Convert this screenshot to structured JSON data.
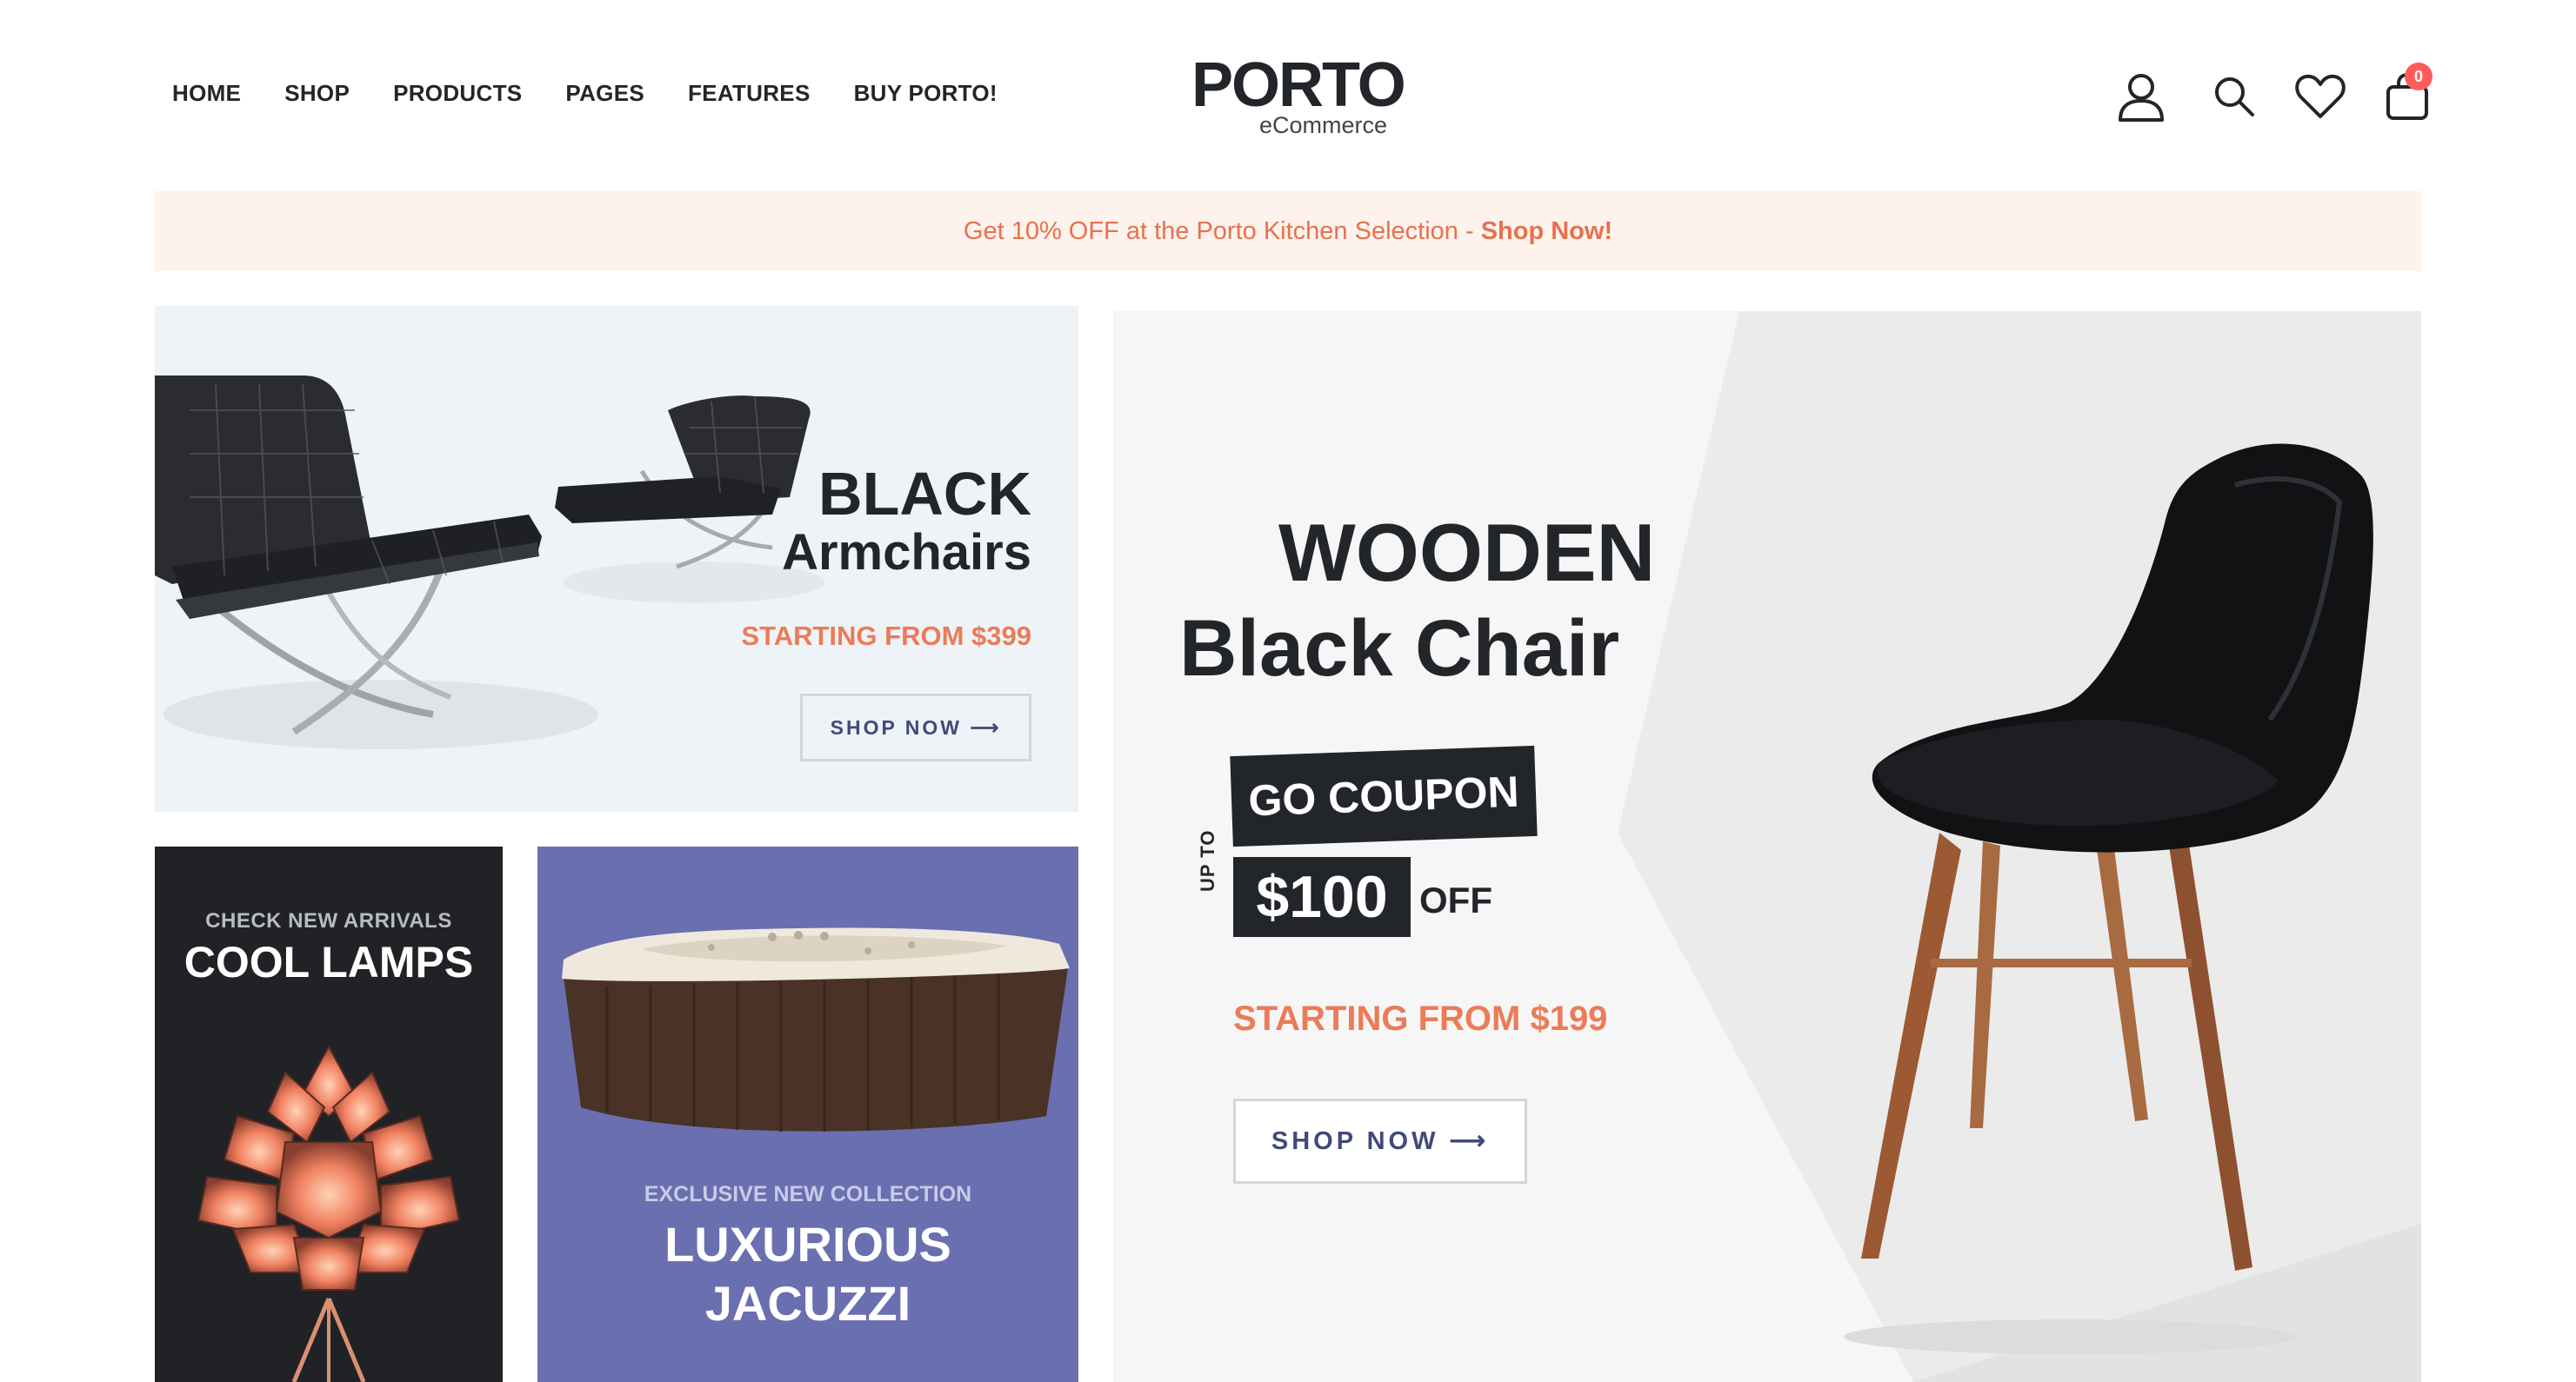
{
  "nav": {
    "items": [
      {
        "label": "HOME"
      },
      {
        "label": "SHOP"
      },
      {
        "label": "PRODUCTS"
      },
      {
        "label": "PAGES"
      },
      {
        "label": "FEATURES"
      },
      {
        "label": "BUY PORTO!"
      }
    ]
  },
  "logo": {
    "wordmark": "PORTO",
    "subtitle": "eCommerce"
  },
  "header_icons": {
    "account": "user-icon",
    "search": "search-icon",
    "wishlist": "heart-icon",
    "cart": "cart-icon",
    "cart_count": "0"
  },
  "promo": {
    "text": "Get 10% OFF at the Porto Kitchen Selection - ",
    "link": "Shop Now!"
  },
  "banner_armchairs": {
    "title_line1": "BLACK",
    "title_line2": "Armchairs",
    "price_text": "STARTING FROM $399",
    "button_label": "SHOP NOW"
  },
  "banner_lamps": {
    "subtitle": "CHECK NEW ARRIVALS",
    "title": "COOL LAMPS"
  },
  "banner_jacuzzi": {
    "subtitle": "EXCLUSIVE NEW COLLECTION",
    "title_line1": "LUXURIOUS",
    "title_line2": "JACUZZI"
  },
  "banner_chair": {
    "title_line1": "WOODEN",
    "title_line2": "Black Chair",
    "coupon_label": "GO COUPON",
    "upto_label": "UP TO",
    "amount": "$100",
    "off_label": "OFF",
    "price_text": "STARTING FROM $199",
    "button_label": "SHOP NOW"
  },
  "colors": {
    "accent": "#ec7b58",
    "dark": "#222529",
    "promo_bg": "#fdf2ec",
    "button_text": "#3f4a78",
    "jacuzzi_bg": "#6a6fb0",
    "badge": "#ff5b5b"
  }
}
